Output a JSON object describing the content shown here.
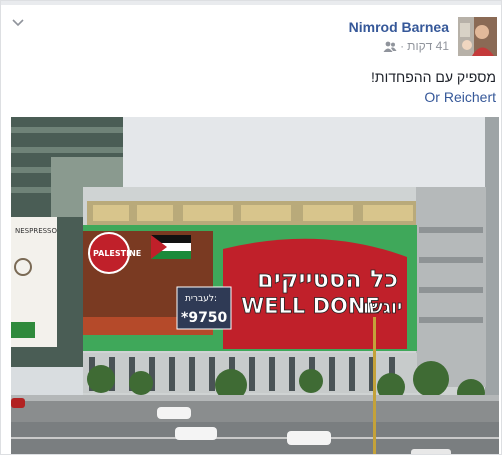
{
  "post": {
    "author_name": "Nimrod Barnea",
    "timestamp": "41 דקות",
    "separator": "·",
    "text": "מספיק עם ההפחדות!",
    "tagged_name": "Or Reichert"
  },
  "photo": {
    "billboard_headline": "כל הסטייקים",
    "billboard_english": "WELL DONE",
    "billboard_hebrew_right": "יוגשו",
    "price_label": "לעברית:",
    "price_number": "*9750",
    "circle_badge": "PALESTINE",
    "espresso_sign": "NESPRESSO",
    "espresso_sign_small": "ESPRESSO"
  },
  "icons": {
    "options": "chevron-down-icon",
    "audience": "friends-icon"
  },
  "colors": {
    "link_blue": "#365899",
    "meta_gray": "#90949c",
    "billboard_green": "#3fa85a",
    "billboard_red": "#c0202a"
  }
}
